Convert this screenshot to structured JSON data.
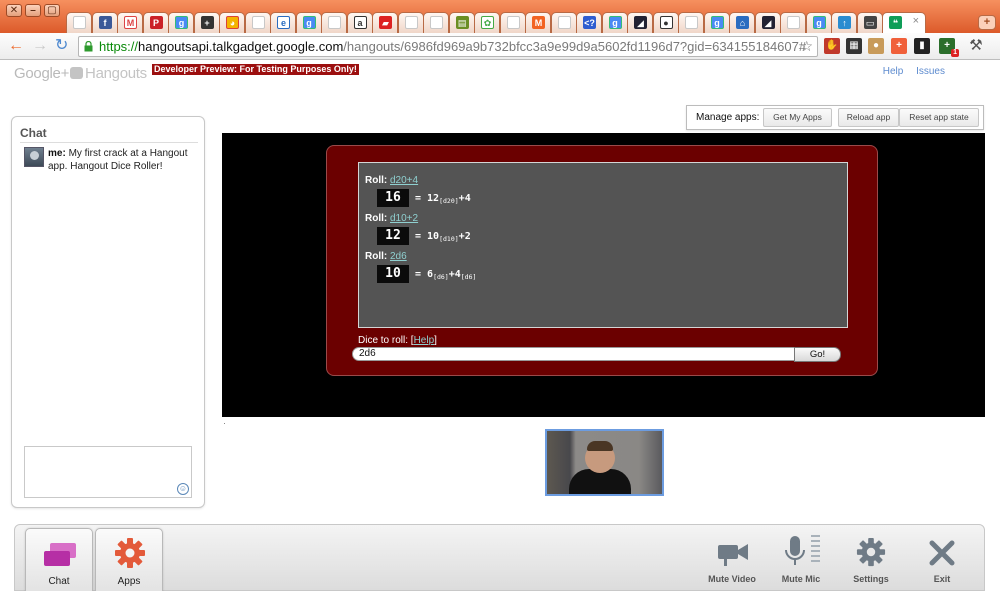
{
  "browser": {
    "window_buttons": [
      "✕",
      "–",
      "▢"
    ],
    "tab_icons": [
      "page-icon",
      "facebook-icon",
      "gmail-icon",
      "pinterest-icon",
      "google-icon",
      "plus-icon",
      "picasa-icon",
      "page-icon",
      "ie-icon",
      "google-icon",
      "page-icon",
      "amazon-icon",
      "red-icon",
      "page-icon",
      "page-icon",
      "green-icon",
      "tree-icon",
      "page-icon",
      "magento-icon",
      "page-icon",
      "stackoverflow-icon",
      "google-icon",
      "pyramid-icon",
      "github-icon",
      "page-icon",
      "google-icon",
      "house-icon",
      "pyramid-icon",
      "page-icon",
      "google-icon",
      "arrow-icon",
      "terminal-icon",
      "hangouts-icon"
    ],
    "active_tab_close": "×",
    "new_tab": "+",
    "url": {
      "scheme": "https://",
      "host": "hangoutsapi.talkgadget.google.com",
      "path": "/hangouts/6986fd969a9b732bfcc3a9e99d9a5602fd1196d7?gid=634155184607#"
    },
    "star": "☆",
    "extensions": [
      "glove-icon",
      "qr-icon",
      "cookie-icon",
      "plus-icon",
      "battery-icon",
      "evernote-icon",
      "wrench-icon"
    ],
    "extension_badge": "1"
  },
  "header": {
    "logo_google": "Google+",
    "logo_hangouts": "Hangouts",
    "preview_banner": "Developer Preview: For Testing Purposes Only!",
    "links": [
      "Help",
      "Issues"
    ]
  },
  "chat": {
    "title": "Chat",
    "messages": [
      {
        "sender": "me:",
        "text": "My first crack at a Hangout app. Hangout Dice Roller!"
      }
    ],
    "smiley": "☺"
  },
  "manage_apps": {
    "label": "Manage apps:",
    "buttons": [
      "Get My Apps",
      "Reload app",
      "Reset app state"
    ]
  },
  "dice_app": {
    "roll_label": "Roll:",
    "rolls": [
      {
        "spec": "d20+4",
        "result": "16",
        "expr_a": "= 12",
        "sub_a": "[d20]",
        "expr_b": "+4",
        "sub_b": ""
      },
      {
        "spec": "d10+2",
        "result": "12",
        "expr_a": "= 10",
        "sub_a": "[d10]",
        "expr_b": "+2",
        "sub_b": ""
      },
      {
        "spec": "2d6",
        "result": "10",
        "expr_a": "= 6",
        "sub_a": "[d6]",
        "expr_b": "+4",
        "sub_b": "[d6]"
      }
    ],
    "input_label": "Dice to roll:",
    "help_open": "[",
    "help_link": "Help",
    "help_close": "]",
    "input_value": "2d6",
    "go_label": "Go!"
  },
  "bottom_bar": {
    "tabs": [
      {
        "label": "Chat",
        "icon": "chat-icon"
      },
      {
        "label": "Apps",
        "icon": "gear-icon"
      }
    ],
    "buttons": [
      {
        "label": "Mute Video",
        "icon": "video-camera-icon"
      },
      {
        "label": "Mute Mic",
        "icon": "microphone-icon"
      },
      {
        "label": "Settings",
        "icon": "settings-icon"
      },
      {
        "label": "Exit",
        "icon": "exit-icon"
      }
    ]
  }
}
